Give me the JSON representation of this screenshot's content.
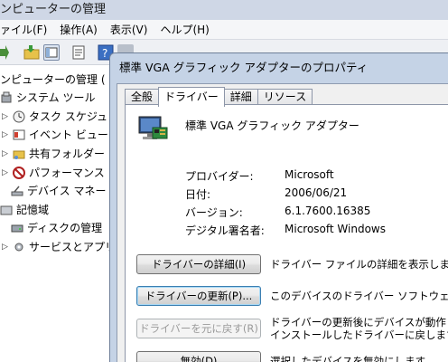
{
  "background_window": {
    "title": "ンピューターの管理",
    "menu": [
      "ァイル(F)",
      "操作(A)",
      "表示(V)",
      "ヘルプ(H)"
    ],
    "tree": [
      {
        "label": "ンピューターの管理 (",
        "arrow": ""
      },
      {
        "label": "システム ツール",
        "arrow": "◢"
      },
      {
        "label": "タスク スケジュ",
        "arrow": "▷"
      },
      {
        "label": "イベント ビュー",
        "arrow": "▷"
      },
      {
        "label": "共有フォルダー",
        "arrow": "▷"
      },
      {
        "label": "パフォーマンス",
        "arrow": "▷"
      },
      {
        "label": "デバイス マネー",
        "arrow": ""
      },
      {
        "label": "記憶域",
        "arrow": "◢"
      },
      {
        "label": "ディスクの管理",
        "arrow": ""
      },
      {
        "label": "サービスとアプリケ",
        "arrow": "▷"
      }
    ]
  },
  "dialog": {
    "title": "標準 VGA グラフィック アダプターのプロパティ",
    "tabs": [
      "全般",
      "ドライバー",
      "詳細",
      "リソース"
    ],
    "device_name": "標準 VGA グラフィック アダプター",
    "info": [
      {
        "label": "プロバイダー:",
        "value": "Microsoft"
      },
      {
        "label": "日付:",
        "value": "2006/06/21"
      },
      {
        "label": "バージョン:",
        "value": "6.1.7600.16385"
      },
      {
        "label": "デジタル署名者:",
        "value": "Microsoft Windows"
      }
    ],
    "actions": [
      {
        "button": "ドライバーの詳細(I)",
        "desc_line1": "ドライバー ファイルの詳細を表示します。",
        "desc_line2": ""
      },
      {
        "button": "ドライバーの更新(P)...",
        "desc_line1": "このデバイスのドライバー ソフトウェアを更新",
        "desc_line2": ""
      },
      {
        "button": "ドライバーを元に戻す(R)",
        "desc_line1": "ドライバーの更新後にデバイスが動作しない",
        "desc_line2": "インストールしたドライバーに戻します。"
      },
      {
        "button": "無効(D)",
        "desc_line1": "選択したデバイスを無効にします。",
        "desc_line2": ""
      }
    ]
  }
}
